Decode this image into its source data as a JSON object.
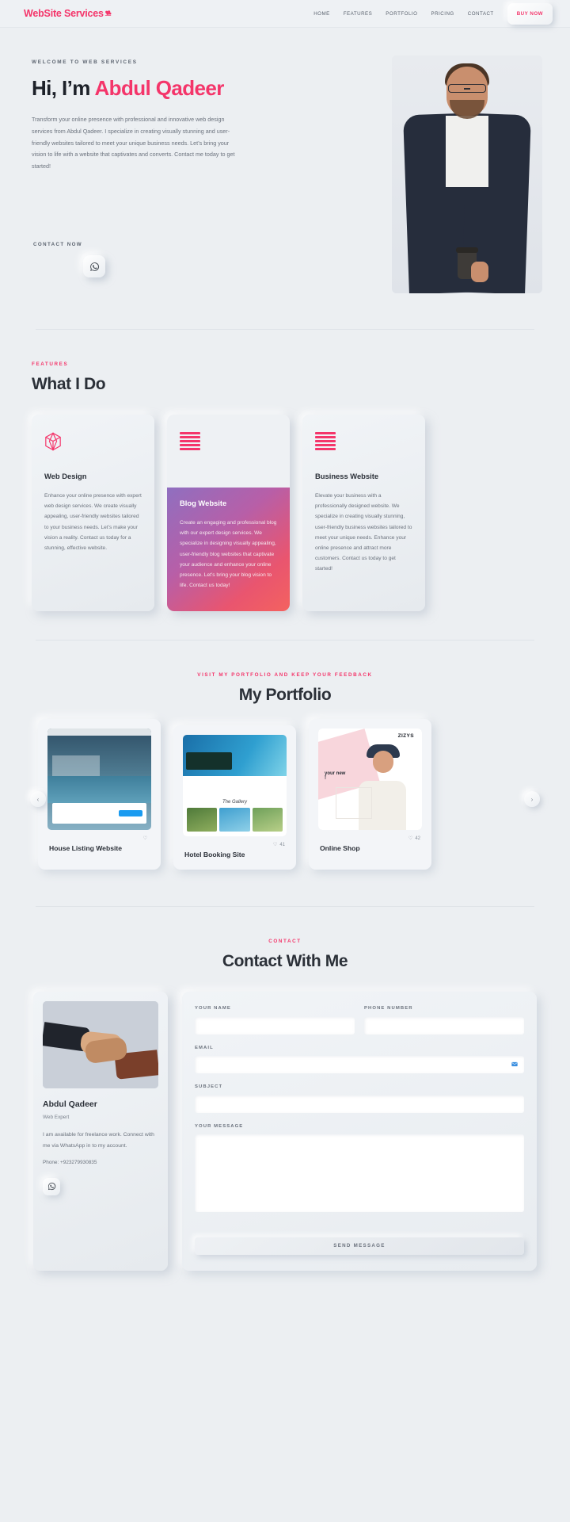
{
  "navbar": {
    "logo_text": "WebSite Services",
    "logo_icon": "flower-icon",
    "links": [
      {
        "label": "HOME"
      },
      {
        "label": "FEATURES"
      },
      {
        "label": "PORTFOLIO"
      },
      {
        "label": "PRICING"
      },
      {
        "label": "CONTACT"
      }
    ],
    "cta_label": "BUY NOW"
  },
  "hero": {
    "eyebrow": "WELCOME TO WEB SERVICES",
    "title_prefix": "Hi, I’m ",
    "title_accent": "Abdul Qadeer",
    "paragraph": "Transform your online presence with professional and innovative web design services from Abdul Qadeer. I specialize in creating visually stunning and user-friendly websites tailored to meet your unique business needs. Let’s bring your vision to life with a website that captivates and converts. Contact me today to get started!",
    "contact_now_label": "CONTACT NOW",
    "whatsapp_icon": "whatsapp-icon",
    "photo_alt": "portrait-of-abdul-qadeer"
  },
  "features": {
    "eyebrow": "FEATURES",
    "title": "What I Do",
    "cards": [
      {
        "icon": "cube-outline-icon",
        "title": "Web Design",
        "copy": "Enhance your online presence with expert web design services. We create visually appealing, user-friendly websites tailored to your business needs. Let’s make your vision a reality. Contact us today for a stunning, effective website."
      },
      {
        "icon": "menu-bars-icon",
        "title": "Blog Website",
        "copy": "Create an engaging and professional blog with our expert design services. We specialize in designing visually appealing, user-friendly blog websites that captivate your audience and enhance your online presence. Let’s bring your blog vision to life. Contact us today!"
      },
      {
        "icon": "menu-bars-icon",
        "title": "Business Website",
        "copy": "Elevate your business with a professionally designed website. We specialize in creating visually stunning, user-friendly business websites tailored to meet your unique needs. Enhance your online presence and attract more customers. Contact us today to get started!"
      }
    ]
  },
  "portfolio": {
    "eyebrow": "VISIT MY PORTFOLIO AND KEEP YOUR FEEDBACK",
    "title": "My Portfolio",
    "prev_icon": "chevron-left-icon",
    "next_icon": "chevron-right-icon",
    "items": [
      {
        "title": "House Listing Website",
        "likes": "",
        "like_icon": "heart-icon",
        "thumb": "house-listing-screenshot"
      },
      {
        "title": "Hotel Booking Site",
        "likes": "41",
        "like_icon": "heart-icon",
        "thumb": "hotel-booking-screenshot"
      },
      {
        "title": "Online Shop",
        "likes": "42",
        "like_icon": "heart-icon",
        "thumb": "online-shop-screenshot"
      }
    ]
  },
  "contact": {
    "eyebrow": "CONTACT",
    "title": "Contact With Me",
    "profile": {
      "photo_alt": "handshake-photo",
      "name": "Abdul Qadeer",
      "role": "Web Expert",
      "copy": "I am available for freelance work. Connect with me via WhatsApp in to my account.",
      "phone": "Phone: +923279930835",
      "whatsapp_icon": "whatsapp-icon"
    },
    "form": {
      "name_label": "YOUR NAME",
      "name_value": "",
      "phone_label": "PHONE NUMBER",
      "phone_value": "",
      "email_label": "EMAIL",
      "email_value": "",
      "email_icon": "mail-icon",
      "subject_label": "SUBJECT",
      "subject_value": "",
      "message_label": "YOUR MESSAGE",
      "message_value": "",
      "submit_label": "SEND MESSAGE"
    }
  },
  "colors": {
    "accent": "#f4356a",
    "background": "#eceff2",
    "text": "#2b3038",
    "muted": "#6b727d"
  }
}
